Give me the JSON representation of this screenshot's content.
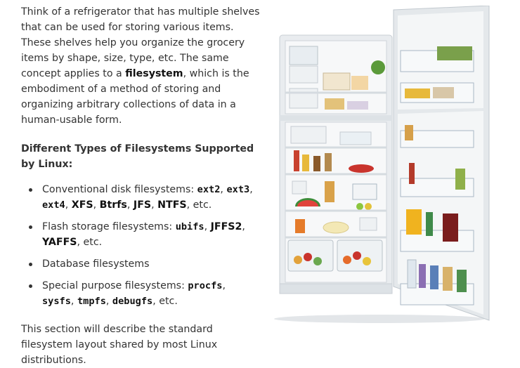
{
  "intro": {
    "before": "Think of a refrigerator that has multiple shelves that can be used for storing various items. These shelves help you organize the grocery items by shape, size, type, etc. The same concept applies to a ",
    "bold": "filesystem",
    "after": ", which is the embodiment of a method of storing and organizing arbitrary collections of data in a human-usable form."
  },
  "heading": "Different Types of Filesystems Supported by Linux:",
  "items": [
    {
      "label": "Conventional disk filesystems: ",
      "codes": [
        "ext2",
        "ext3",
        "ext4"
      ],
      "bolds": [
        "XFS",
        "Btrfs",
        "JFS",
        "NTFS"
      ],
      "suffix": " etc."
    },
    {
      "label": "Flash storage filesystems: ",
      "codes": [
        "ubifs"
      ],
      "bolds": [
        "JFFS2",
        "YAFFS"
      ],
      "suffix": " etc."
    },
    {
      "label": "Database filesystems"
    },
    {
      "label": "Special purpose filesystems: ",
      "codes": [
        "procfs",
        "sysfs",
        "tmpfs",
        "debugfs"
      ],
      "suffix": " etc."
    }
  ],
  "outro": "This section will describe the standard filesystem layout shared by most Linux distributions.",
  "colors": {
    "text": "#333333",
    "fridge_body": "#e9ecef",
    "fridge_inner": "#f7f8f9",
    "shelf": "#d5dbe0"
  },
  "image": {
    "icon": "open-refrigerator-illustration"
  }
}
